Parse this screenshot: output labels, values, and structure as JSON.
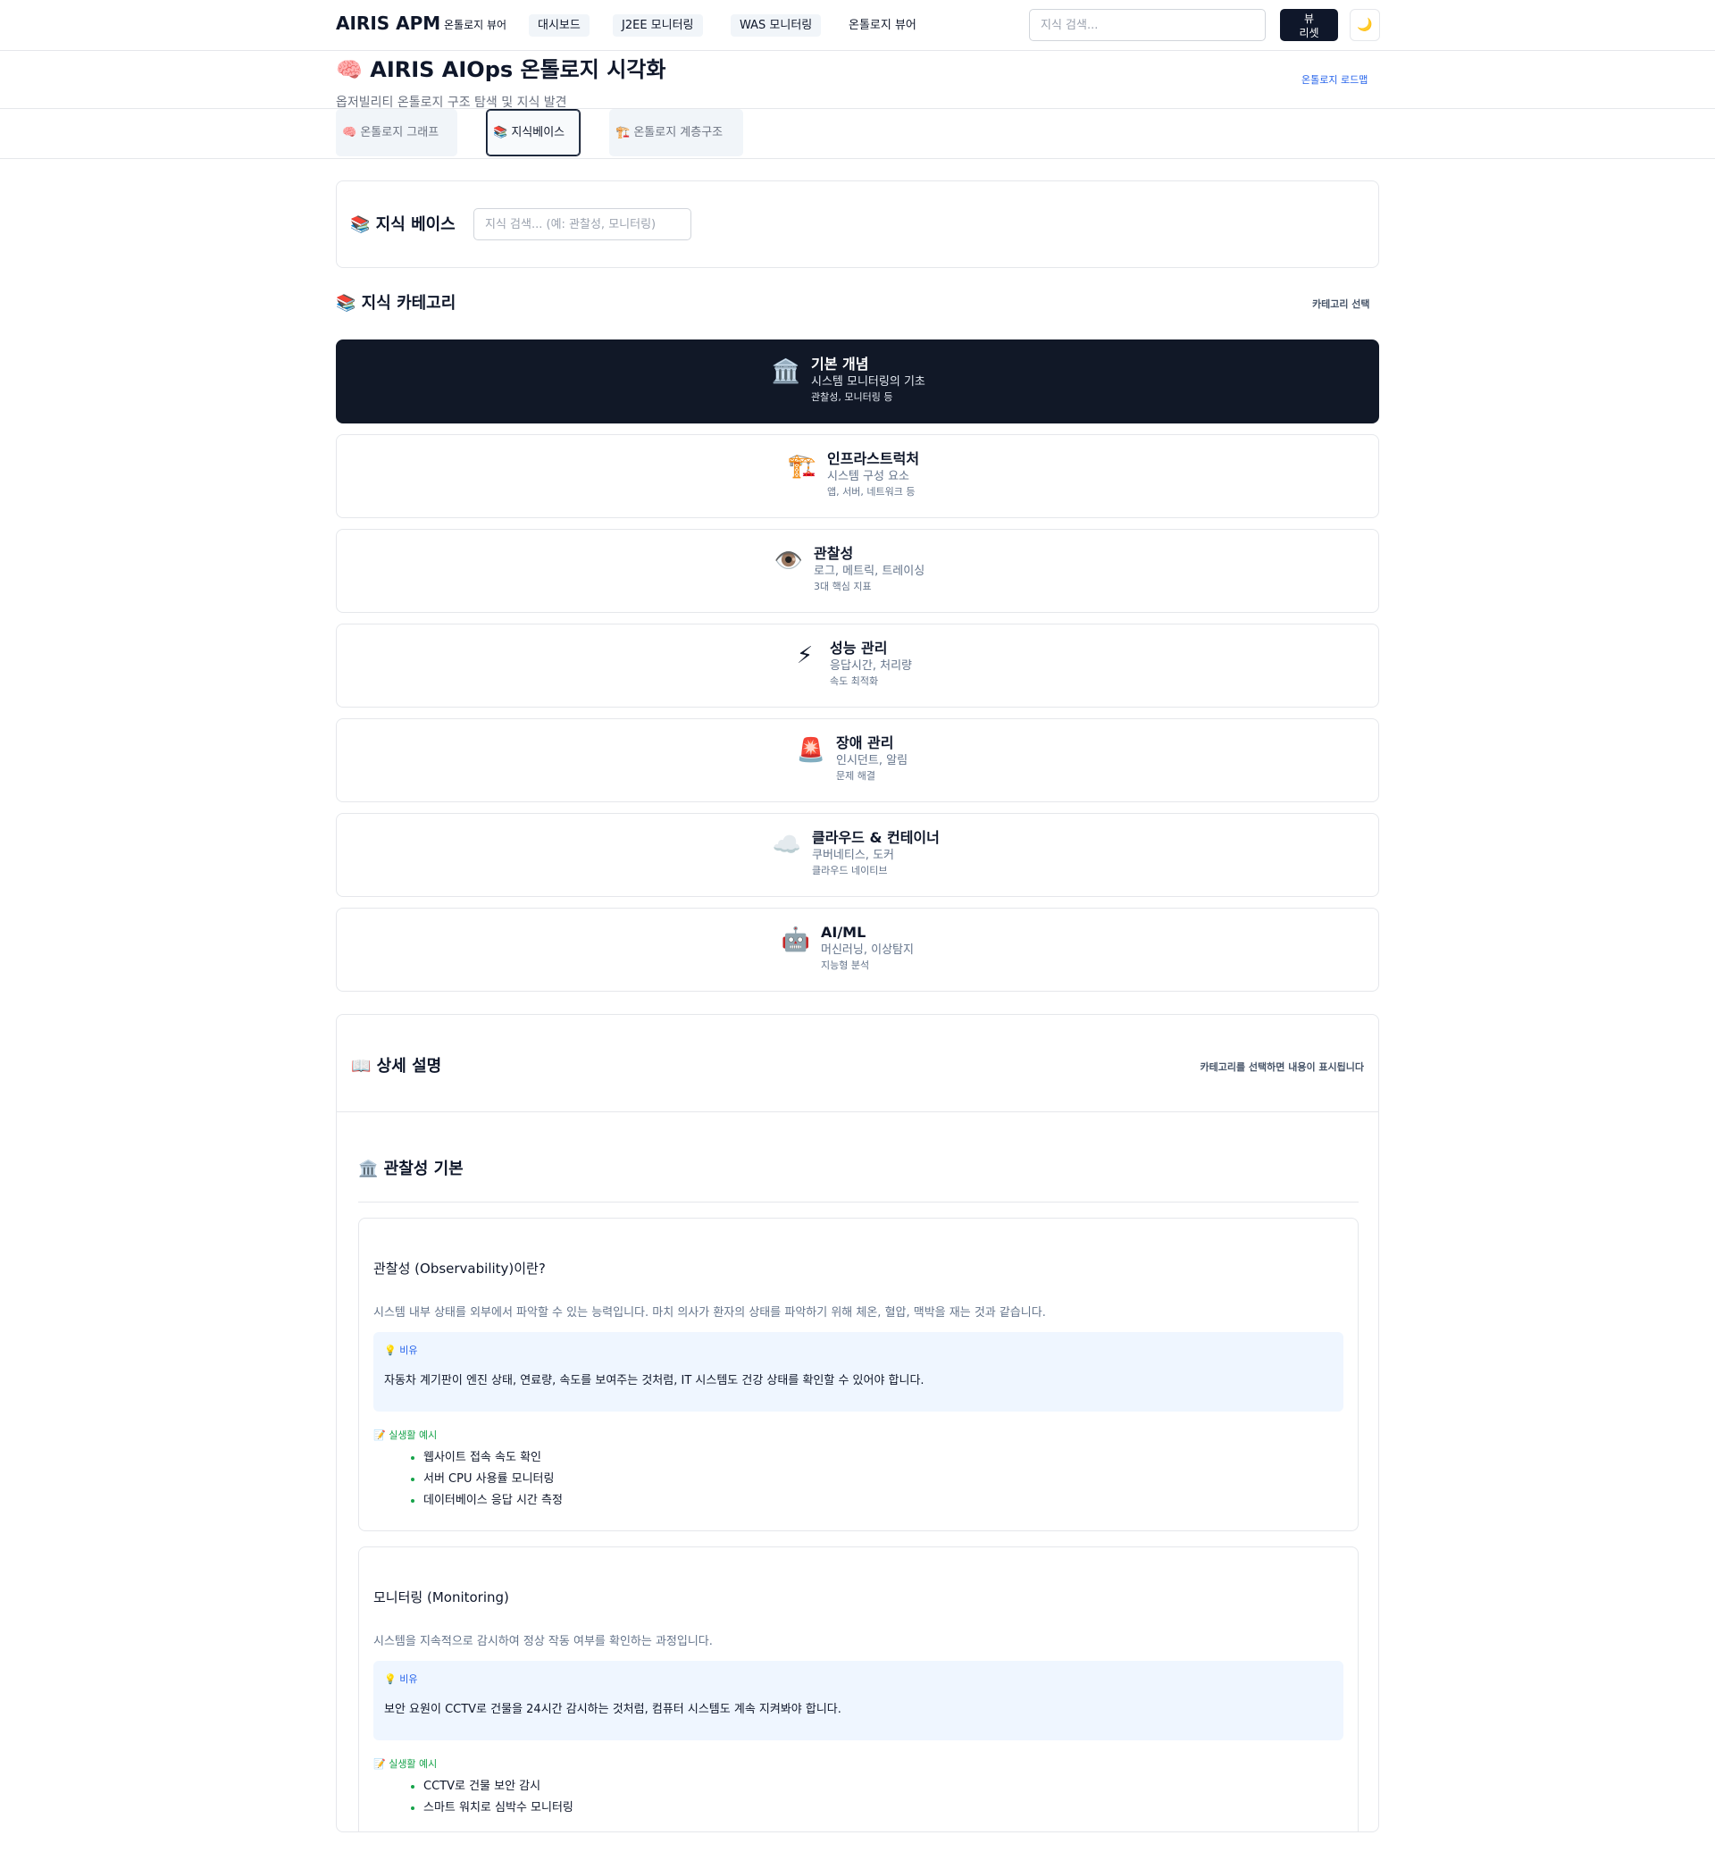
{
  "nav": {
    "brand": "AIRIS APM",
    "links": [
      "온톨로지 뷰어",
      "대시보드",
      "J2EE 모니터링",
      "WAS 모니터링",
      "온톨로지 뷰어"
    ],
    "search_placeholder": "지식 검색...",
    "reset_label": "뷰\n리셋",
    "theme_icon": "🌙"
  },
  "header": {
    "title": "🧠 AIRIS AIOps 온톨로지 시각화",
    "subtitle": "옵저빌리티 온톨로지 구조 탐색 및 지식 발견",
    "roadmap_link": "온톨로지 로드맵"
  },
  "tabs": [
    {
      "label": "🧠 온톨로지 그래프"
    },
    {
      "label": "📚 지식베이스"
    },
    {
      "label": "🏗️ 온톨로지 계층구조"
    }
  ],
  "kb": {
    "title": "📚 지식 베이스",
    "search_placeholder": "지식 검색... (예: 관찰성, 모니터링)"
  },
  "categories_section": {
    "heading": "📚 지식 카테고리",
    "select_hint": "카테고리 선택"
  },
  "categories": [
    {
      "icon": "🏛️",
      "name": "기본 개념",
      "desc": "시스템 모니터링의 기초",
      "tag": "관찰성, 모니터링 등"
    },
    {
      "icon": "🏗️",
      "name": "인프라스트럭처",
      "desc": "시스템 구성 요소",
      "tag": "앱, 서버, 네트워크 등"
    },
    {
      "icon": "👁️",
      "name": "관찰성",
      "desc": "로그, 메트릭, 트레이싱",
      "tag": "3대 핵심 지표"
    },
    {
      "icon": "⚡",
      "name": "성능 관리",
      "desc": "응답시간, 처리량",
      "tag": "속도 최적화"
    },
    {
      "icon": "🚨",
      "name": "장애 관리",
      "desc": "인시던트, 알림",
      "tag": "문제 해결"
    },
    {
      "icon": "☁️",
      "name": "클라우드 & 컨테이너",
      "desc": "쿠버네티스, 도커",
      "tag": "클라우드 네이티브"
    },
    {
      "icon": "🤖",
      "name": "AI/ML",
      "desc": "머신러닝, 이상탐지",
      "tag": "지능형 분석"
    }
  ],
  "detail": {
    "title": "📖 상세 설명",
    "hint": "카테고리를 선택하면 내용이 표시됩니다",
    "section_title": "🏛️ 관찰성 기본",
    "concepts": [
      {
        "title": "관찰성 (Observability)이란?",
        "desc": "시스템 내부 상태를 외부에서 파악할 수 있는 능력입니다. 마치 의사가 환자의 상태를 파악하기 위해 체온, 혈압, 맥박을 재는 것과 같습니다.",
        "analogy_label": "💡 비유",
        "analogy": "자동차 계기판이 엔진 상태, 연료량, 속도를 보여주는 것처럼, IT 시스템도 건강 상태를 확인할 수 있어야 합니다.",
        "example_label": "📝 실생활 예시",
        "examples": [
          "웹사이트 접속 속도 확인",
          "서버 CPU 사용률 모니터링",
          "데이터베이스 응답 시간 측정"
        ]
      },
      {
        "title": "모니터링 (Monitoring)",
        "desc": "시스템을 지속적으로 감시하여 정상 작동 여부를 확인하는 과정입니다.",
        "analogy_label": "💡 비유",
        "analogy": "보안 요원이 CCTV로 건물을 24시간 감시하는 것처럼, 컴퓨터 시스템도 계속 지켜봐야 합니다.",
        "example_label": "📝 실생활 예시",
        "examples": [
          "CCTV로 건물 보안 감시",
          "스마트 워치로 심박수 모니터링"
        ]
      }
    ]
  }
}
